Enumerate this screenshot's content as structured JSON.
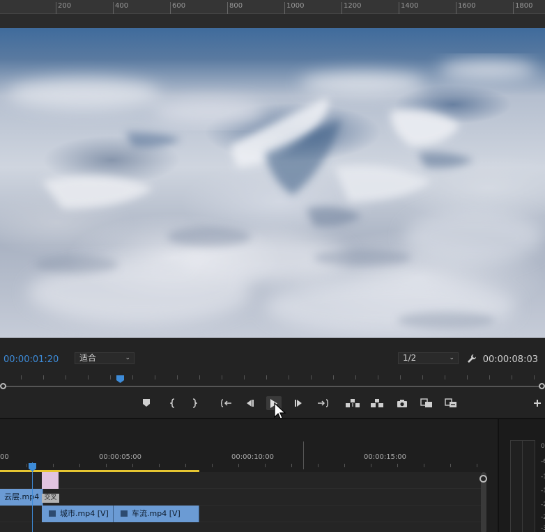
{
  "ruler": {
    "labels": [
      "200",
      "400",
      "600",
      "800",
      "1000",
      "1200",
      "1400",
      "1600",
      "1800"
    ]
  },
  "monitor": {
    "current_timecode": "00:00:01:20",
    "duration_timecode": "00:00:08:03",
    "zoom_level": "适合",
    "resolution": "1/2"
  },
  "transport": {
    "icons": [
      "marker-icon",
      "mark-in-icon",
      "mark-out-icon",
      "go-to-in-icon",
      "step-back-icon",
      "play-icon",
      "step-forward-icon",
      "go-to-out-icon",
      "lift-icon",
      "extract-icon",
      "export-frame-icon",
      "comparison-view-icon",
      "proxy-toggle-icon",
      "add-button-icon"
    ]
  },
  "timeline": {
    "ruler_labels": [
      "00",
      "00:00:05:00",
      "00:00:10:00",
      "00:00:15:00"
    ],
    "clips": {
      "track_v2": "云层.mp4 [",
      "track_v1_a": "城市.mp4 [V]",
      "track_v1_b": "车流.mp4 [V]"
    },
    "transition_label": "交叉"
  },
  "meter": {
    "ticks": [
      "0",
      "-6",
      "-1",
      "-1",
      "-2",
      "-2",
      "-3"
    ]
  },
  "colors": {
    "accent": "#3d8bd8",
    "clip": "#6b9bd4",
    "workbar": "#e6c632",
    "transition": "#e1c3e0"
  }
}
